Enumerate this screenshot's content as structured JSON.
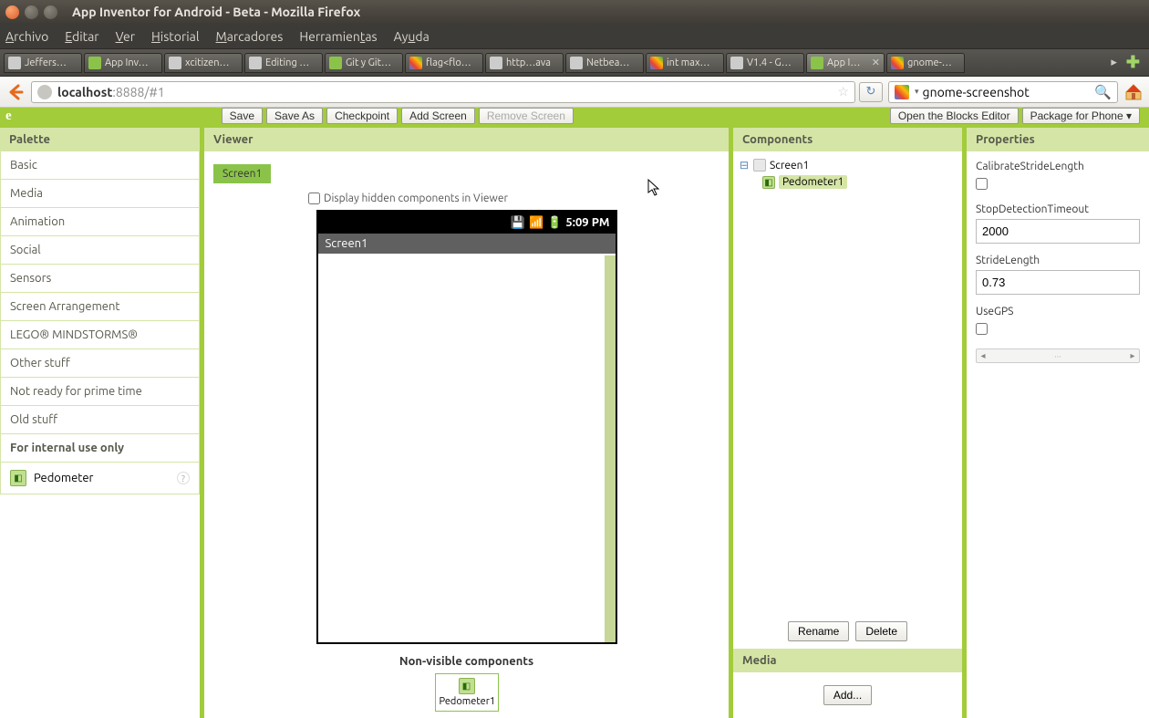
{
  "window": {
    "title": "App Inventor for Android - Beta - Mozilla Firefox"
  },
  "menubar": {
    "items": [
      "Archivo",
      "Editar",
      "Ver",
      "Historial",
      "Marcadores",
      "Herramientas",
      "Ayuda"
    ]
  },
  "tabs": {
    "items": [
      {
        "label": "Jeffers…",
        "active": false,
        "fav": "gh"
      },
      {
        "label": "App Inv…",
        "active": false,
        "fav": "ai"
      },
      {
        "label": "xcitizen…",
        "active": false,
        "fav": "gh"
      },
      {
        "label": "Editing …",
        "active": false,
        "fav": "gh"
      },
      {
        "label": "Git y Git…",
        "active": false,
        "fav": "ai"
      },
      {
        "label": "flag<flo…",
        "active": false,
        "fav": "g"
      },
      {
        "label": "http…ava",
        "active": false,
        "fav": "gh"
      },
      {
        "label": "Netbea…",
        "active": false,
        "fav": "gh"
      },
      {
        "label": "int max…",
        "active": false,
        "fav": "g"
      },
      {
        "label": "V1.4 - G…",
        "active": false,
        "fav": "gh"
      },
      {
        "label": "App I…",
        "active": true,
        "fav": "ai",
        "closeable": true
      },
      {
        "label": "gnome-…",
        "active": false,
        "fav": "g"
      }
    ]
  },
  "addressbar": {
    "host": "localhost",
    "rest": ":8888/#1",
    "search_value": "gnome-screenshot"
  },
  "toolbar": {
    "logo": "e",
    "left": [
      {
        "id": "save",
        "label": "Save"
      },
      {
        "id": "saveas",
        "label": "Save As"
      },
      {
        "id": "checkpoint",
        "label": "Checkpoint"
      },
      {
        "id": "addscreen",
        "label": "Add Screen"
      },
      {
        "id": "removescreen",
        "label": "Remove Screen",
        "disabled": true
      }
    ],
    "right": [
      {
        "id": "blocks",
        "label": "Open the Blocks Editor"
      },
      {
        "id": "package",
        "label": "Package for Phone ▾"
      }
    ]
  },
  "palette": {
    "header": "Palette",
    "categories": [
      "Basic",
      "Media",
      "Animation",
      "Social",
      "Sensors",
      "Screen Arrangement",
      "LEGO® MINDSTORMS®",
      "Other stuff",
      "Not ready for prime time",
      "Old stuff"
    ],
    "internal_header": "For internal use only",
    "internal_items": [
      {
        "name": "Pedometer"
      }
    ]
  },
  "viewer": {
    "header": "Viewer",
    "screen_tab": "Screen1",
    "hidden_checkbox_label": "Display hidden components in Viewer",
    "phone": {
      "time": "5:09 PM",
      "title": "Screen1"
    },
    "nonvisible_header": "Non-visible components",
    "nonvisible_items": [
      {
        "name": "Pedometer1"
      }
    ]
  },
  "components": {
    "header": "Components",
    "tree": {
      "root": "Screen1",
      "children": [
        {
          "name": "Pedometer1",
          "selected": true
        }
      ]
    },
    "rename": "Rename",
    "delete": "Delete",
    "media_header": "Media",
    "add": "Add..."
  },
  "properties": {
    "header": "Properties",
    "CalibrateStrideLength_label": "CalibrateStrideLength",
    "CalibrateStrideLength_value": false,
    "StopDetectionTimeout_label": "StopDetectionTimeout",
    "StopDetectionTimeout_value": "2000",
    "StrideLength_label": "StrideLength",
    "StrideLength_value": "0.73",
    "UseGPS_label": "UseGPS",
    "UseGPS_value": false
  }
}
